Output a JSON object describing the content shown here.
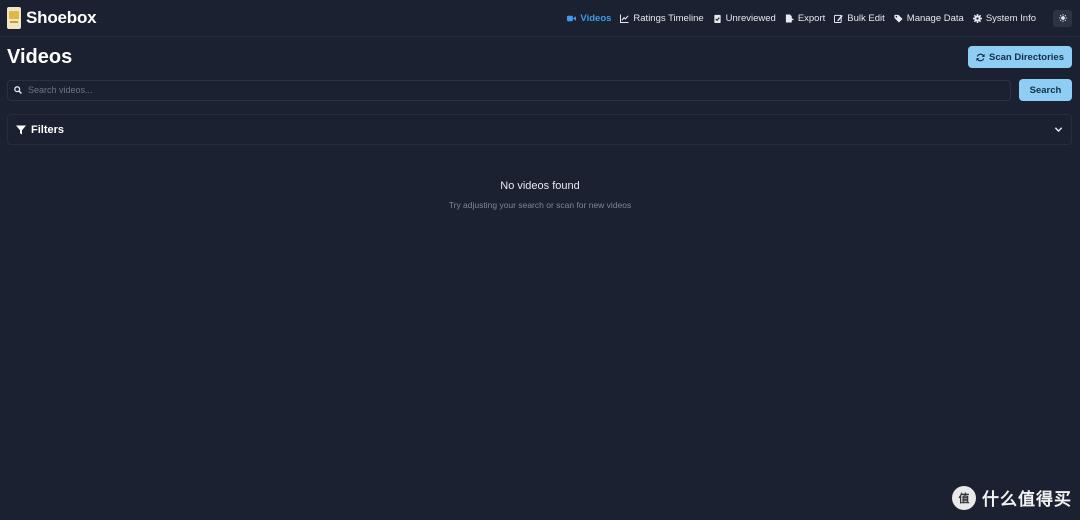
{
  "app": {
    "name": "Shoebox"
  },
  "nav": {
    "items": [
      {
        "label": "Videos",
        "icon": "video-camera-icon",
        "active": true
      },
      {
        "label": "Ratings Timeline",
        "icon": "chart-line-icon",
        "active": false
      },
      {
        "label": "Unreviewed",
        "icon": "clipboard-check-icon",
        "active": false
      },
      {
        "label": "Export",
        "icon": "file-export-icon",
        "active": false
      },
      {
        "label": "Bulk Edit",
        "icon": "edit-icon",
        "active": false
      },
      {
        "label": "Manage Data",
        "icon": "tags-icon",
        "active": false
      },
      {
        "label": "System Info",
        "icon": "gear-icon",
        "active": false
      }
    ],
    "theme_toggle_icon": "sun-icon"
  },
  "page": {
    "title": "Videos",
    "scan_button": "Scan Directories"
  },
  "search": {
    "placeholder": "Search videos...",
    "value": "",
    "button": "Search"
  },
  "filters": {
    "label": "Filters"
  },
  "empty_state": {
    "title": "No videos found",
    "subtitle": "Try adjusting your search or scan for new videos"
  },
  "watermark": {
    "text": "什么值得买"
  },
  "colors": {
    "background": "#1b2130",
    "accent": "#3d9be9",
    "primary_button": "#8ecdf4"
  }
}
